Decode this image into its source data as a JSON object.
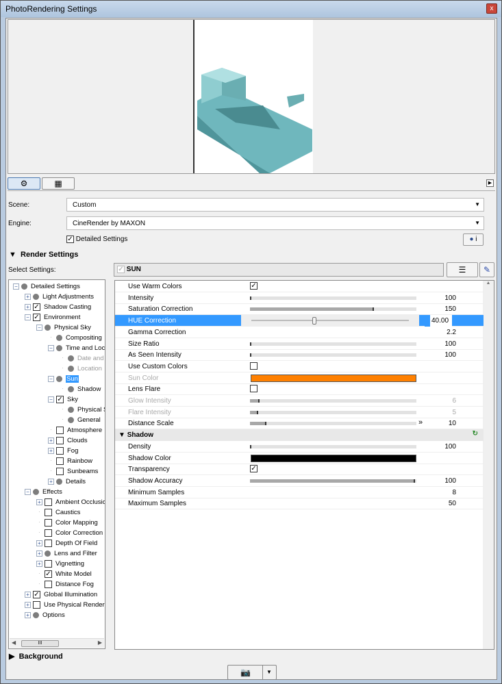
{
  "window": {
    "title": "PhotoRendering Settings",
    "close": "x"
  },
  "tabs": [
    {
      "icon": "gear-icon",
      "glyph": "⚙",
      "active": true
    },
    {
      "icon": "film-icon",
      "glyph": "▦",
      "active": false
    }
  ],
  "scene": {
    "label": "Scene:",
    "value": "Custom"
  },
  "engine": {
    "label": "Engine:",
    "value": "CineRender by MAXON"
  },
  "detailed_settings": {
    "label": "Detailed Settings",
    "checked": true
  },
  "render_settings": {
    "title": "Render Settings"
  },
  "select_settings_label": "Select Settings:",
  "tree": [
    {
      "level": 0,
      "exp": "-",
      "m": "dot",
      "label": "Detailed Settings"
    },
    {
      "level": 1,
      "exp": "+",
      "m": "dot",
      "label": "Light Adjustments"
    },
    {
      "level": 1,
      "exp": "+",
      "m": "check",
      "label": "Shadow Casting"
    },
    {
      "level": 1,
      "exp": "-",
      "m": "check",
      "label": "Environment"
    },
    {
      "level": 2,
      "exp": "-",
      "m": "dot",
      "label": "Physical Sky"
    },
    {
      "level": 3,
      "exp": "",
      "m": "dot",
      "label": "Compositing"
    },
    {
      "level": 3,
      "exp": "-",
      "m": "dot",
      "label": "Time and Location"
    },
    {
      "level": 4,
      "exp": "",
      "m": "dot",
      "label": "Date and Time",
      "dis": true
    },
    {
      "level": 4,
      "exp": "",
      "m": "dot",
      "label": "Location",
      "dis": true
    },
    {
      "level": 3,
      "exp": "-",
      "m": "dot",
      "label": "Sun",
      "sel": true
    },
    {
      "level": 4,
      "exp": "",
      "m": "dot",
      "label": "Shadow"
    },
    {
      "level": 3,
      "exp": "-",
      "m": "check",
      "label": "Sky"
    },
    {
      "level": 4,
      "exp": "",
      "m": "dot",
      "label": "Physical Sky"
    },
    {
      "level": 4,
      "exp": "",
      "m": "dot",
      "label": "General"
    },
    {
      "level": 3,
      "exp": "",
      "m": "box",
      "label": "Atmosphere"
    },
    {
      "level": 3,
      "exp": "+",
      "m": "box",
      "label": "Clouds"
    },
    {
      "level": 3,
      "exp": "+",
      "m": "box",
      "label": "Fog"
    },
    {
      "level": 3,
      "exp": "",
      "m": "box",
      "label": "Rainbow"
    },
    {
      "level": 3,
      "exp": "",
      "m": "box",
      "label": "Sunbeams"
    },
    {
      "level": 3,
      "exp": "+",
      "m": "dot",
      "label": "Details"
    },
    {
      "level": 1,
      "exp": "-",
      "m": "dot",
      "label": "Effects"
    },
    {
      "level": 2,
      "exp": "+",
      "m": "box",
      "label": "Ambient Occlusion"
    },
    {
      "level": 2,
      "exp": "",
      "m": "box",
      "label": "Caustics"
    },
    {
      "level": 2,
      "exp": "",
      "m": "box",
      "label": "Color Mapping"
    },
    {
      "level": 2,
      "exp": "",
      "m": "box",
      "label": "Color Correction"
    },
    {
      "level": 2,
      "exp": "+",
      "m": "box",
      "label": "Depth Of Field"
    },
    {
      "level": 2,
      "exp": "+",
      "m": "dot",
      "label": "Lens and Filter"
    },
    {
      "level": 2,
      "exp": "+",
      "m": "box",
      "label": "Vignetting"
    },
    {
      "level": 2,
      "exp": "",
      "m": "check",
      "label": "White Model"
    },
    {
      "level": 2,
      "exp": "",
      "m": "box",
      "label": "Distance Fog"
    },
    {
      "level": 1,
      "exp": "+",
      "m": "check",
      "label": "Global Illumination"
    },
    {
      "level": 1,
      "exp": "+",
      "m": "box",
      "label": "Use Physical Renderer"
    },
    {
      "level": 1,
      "exp": "+",
      "m": "dot",
      "label": "Options"
    }
  ],
  "tree_scroll_thumb": "III",
  "panel": {
    "title": "SUN",
    "group_checked": true
  },
  "properties": [
    {
      "label": "Use Warm Colors",
      "type": "check",
      "checked": true
    },
    {
      "label": "Intensity",
      "type": "slider",
      "fraction": 0.0,
      "value": "100"
    },
    {
      "label": "Saturation Correction",
      "type": "slider",
      "fraction": 0.75,
      "value": "150"
    },
    {
      "label": "HUE Correction",
      "type": "edit",
      "fraction": 0.4,
      "value": "40.00"
    },
    {
      "label": "Gamma Correction",
      "type": "value",
      "value": "2.2"
    },
    {
      "label": "Size Ratio",
      "type": "slider",
      "fraction": 0.0,
      "value": "100"
    },
    {
      "label": "As Seen Intensity",
      "type": "slider",
      "fraction": 0.0,
      "value": "100"
    },
    {
      "label": "Use Custom Colors",
      "type": "check",
      "checked": false
    },
    {
      "label": "Sun Color",
      "type": "color",
      "color": "#ff8000",
      "dis": true
    },
    {
      "label": "Lens Flare",
      "type": "check",
      "checked": false
    },
    {
      "label": "Glow Intensity",
      "type": "slider",
      "fraction": 0.06,
      "value": "6",
      "dis": true
    },
    {
      "label": "Flare Intensity",
      "type": "slider",
      "fraction": 0.05,
      "value": "5",
      "dis": true
    },
    {
      "label": "Distance Scale",
      "type": "slider",
      "fraction": 0.1,
      "value": "10",
      "arrow": true
    }
  ],
  "shadow_group": {
    "title": "Shadow"
  },
  "shadow_properties": [
    {
      "label": "Density",
      "type": "slider",
      "fraction": 0.0,
      "value": "100"
    },
    {
      "label": "Shadow Color",
      "type": "color",
      "color": "#000000"
    },
    {
      "label": "Transparency",
      "type": "check",
      "checked": true
    },
    {
      "label": "Shadow Accuracy",
      "type": "slider",
      "fraction": 1.0,
      "value": "100"
    },
    {
      "label": "Minimum Samples",
      "type": "value",
      "value": "8"
    },
    {
      "label": "Maximum Samples",
      "type": "value",
      "value": "50"
    }
  ],
  "background": {
    "title": "Background"
  },
  "colors": {
    "selection": "#3399ff",
    "sun_color": "#ff8000"
  }
}
